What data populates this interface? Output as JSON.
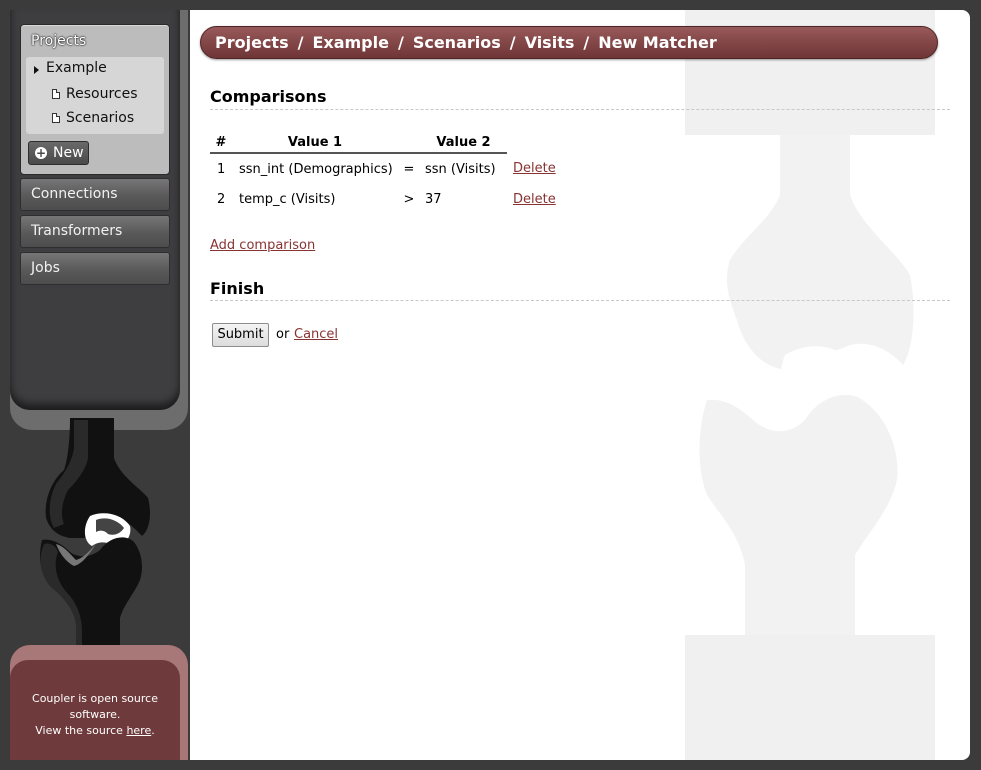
{
  "sidebar": {
    "projects_title": "Projects",
    "project_items": [
      {
        "label": "Example"
      },
      {
        "label": "Resources"
      },
      {
        "label": "Scenarios"
      }
    ],
    "new_button": "New",
    "nav": [
      {
        "label": "Connections"
      },
      {
        "label": "Transformers"
      },
      {
        "label": "Jobs"
      }
    ]
  },
  "footer": {
    "line1": "Coupler is open source",
    "line2": "software.",
    "line3_prefix": "View the source ",
    "line3_link": "here",
    "line3_suffix": "."
  },
  "breadcrumb": [
    "Projects",
    "Example",
    "Scenarios",
    "Visits",
    "New Matcher"
  ],
  "comparisons": {
    "heading": "Comparisons",
    "columns": [
      "#",
      "Value 1",
      "",
      "Value 2",
      ""
    ],
    "rows": [
      {
        "num": "1",
        "value1": "ssn_int (Demographics)",
        "op": "=",
        "value2": "ssn (Visits)",
        "action": "Delete"
      },
      {
        "num": "2",
        "value1": "temp_c (Visits)",
        "op": ">",
        "value2": "37",
        "action": "Delete"
      }
    ],
    "add_link": "Add comparison"
  },
  "finish": {
    "heading": "Finish",
    "submit": "Submit",
    "or_text": "or",
    "cancel": "Cancel"
  },
  "colors": {
    "accent": "#7a3e3f",
    "link": "#883333",
    "sidebar_bg": "#3e3d3f"
  }
}
